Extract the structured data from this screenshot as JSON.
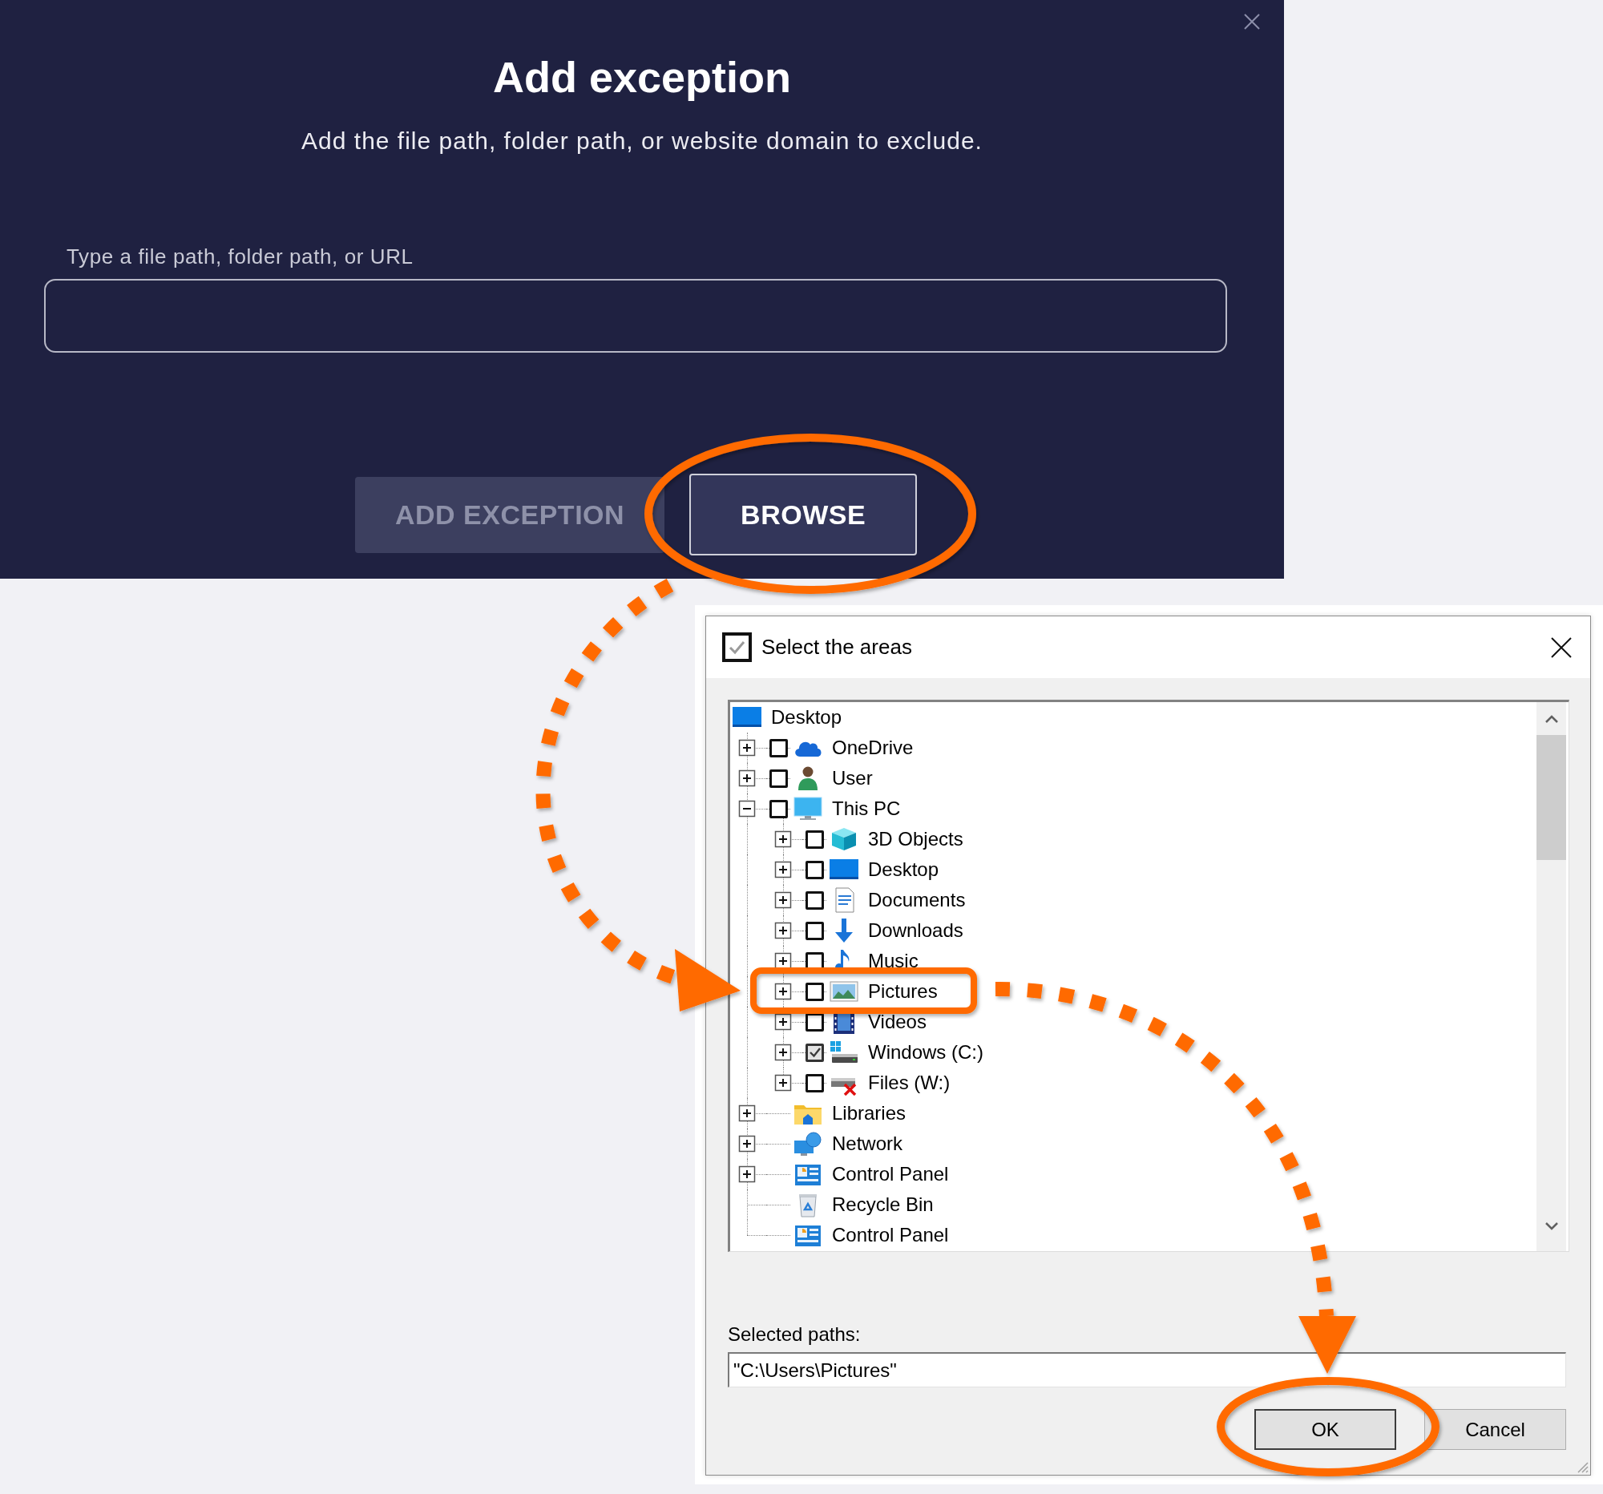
{
  "exception_dialog": {
    "title": "Add exception",
    "subtitle": "Add the file path, folder path, or website domain to exclude.",
    "field_label": "Type a file path, folder path, or URL",
    "buttons": [
      {
        "label": "ADD EXCEPTION",
        "disabled": true
      },
      {
        "label": "BROWSE",
        "disabled": false
      }
    ]
  },
  "select_dialog": {
    "title": "Select the areas",
    "tree": {
      "label": "Desktop",
      "children": [
        {
          "label": "OneDrive",
          "kind": "check",
          "checked": false,
          "expanded": false
        },
        {
          "label": "User",
          "kind": "check",
          "checked": false,
          "expanded": false
        },
        {
          "label": "This PC",
          "kind": "check",
          "checked": false,
          "expanded": true,
          "children": [
            {
              "label": "3D Objects",
              "kind": "check",
              "checked": false,
              "expanded": false
            },
            {
              "label": "Desktop",
              "kind": "check",
              "checked": false,
              "expanded": false
            },
            {
              "label": "Documents",
              "kind": "check",
              "checked": false,
              "expanded": false
            },
            {
              "label": "Downloads",
              "kind": "check",
              "checked": false,
              "expanded": false
            },
            {
              "label": "Music",
              "kind": "check",
              "checked": false,
              "expanded": false
            },
            {
              "label": "Pictures",
              "kind": "check",
              "checked": false,
              "expanded": false
            },
            {
              "label": "Videos",
              "kind": "check",
              "checked": false,
              "expanded": false
            },
            {
              "label": "Windows (C:)",
              "kind": "check",
              "checked": true,
              "expanded": false
            },
            {
              "label": "Files (W:)",
              "kind": "check",
              "checked": false,
              "expanded": false
            }
          ]
        },
        {
          "label": "Libraries",
          "kind": "plain",
          "expanded": false
        },
        {
          "label": "Network",
          "kind": "plain",
          "expanded": false
        },
        {
          "label": "Control Panel",
          "kind": "plain",
          "expanded": false
        },
        {
          "label": "Recycle Bin",
          "kind": "plain"
        },
        {
          "label": "Control Panel",
          "kind": "plain"
        }
      ]
    },
    "selected_paths_label": "Selected paths:",
    "selected_paths": "\"C:\\Users\\Pictures\"",
    "buttons": [
      {
        "label": "OK",
        "default": true
      },
      {
        "label": "Cancel",
        "default": false
      }
    ]
  },
  "annotations": [
    {
      "kind": "ring"
    },
    {
      "kind": "dotted_arrow"
    },
    {
      "kind": "highlight"
    },
    {
      "kind": "dotted_arrow"
    },
    {
      "kind": "ring"
    }
  ]
}
